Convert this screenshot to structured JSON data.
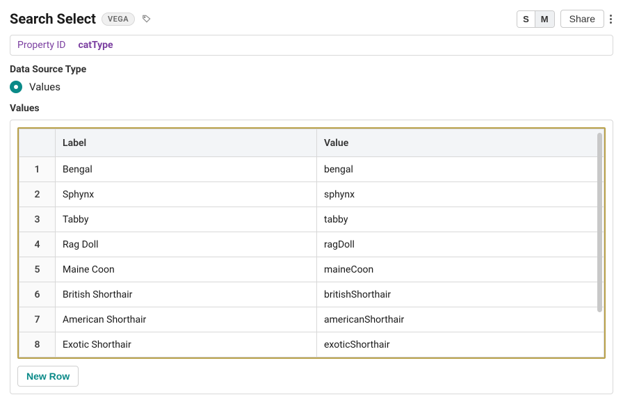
{
  "header": {
    "title": "Search Select",
    "badge": "VEGA",
    "sizes": [
      "S",
      "M"
    ],
    "active_size": "M",
    "share_label": "Share"
  },
  "property_bar": {
    "label": "Property ID",
    "value": "catType"
  },
  "data_source": {
    "section_label": "Data Source Type",
    "option_label": "Values",
    "selected": true
  },
  "values_section": {
    "title": "Values",
    "columns": [
      "Label",
      "Value"
    ],
    "rows": [
      {
        "idx": "1",
        "label": "Bengal",
        "value": "bengal"
      },
      {
        "idx": "2",
        "label": "Sphynx",
        "value": "sphynx"
      },
      {
        "idx": "3",
        "label": "Tabby",
        "value": "tabby"
      },
      {
        "idx": "4",
        "label": "Rag Doll",
        "value": "ragDoll"
      },
      {
        "idx": "5",
        "label": "Maine Coon",
        "value": "maineCoon"
      },
      {
        "idx": "6",
        "label": "British Shorthair",
        "value": "britishShorthair"
      },
      {
        "idx": "7",
        "label": "American Shorthair",
        "value": "americanShorthair"
      },
      {
        "idx": "8",
        "label": "Exotic Shorthair",
        "value": "exoticShorthair"
      }
    ],
    "new_row_label": "New Row"
  }
}
